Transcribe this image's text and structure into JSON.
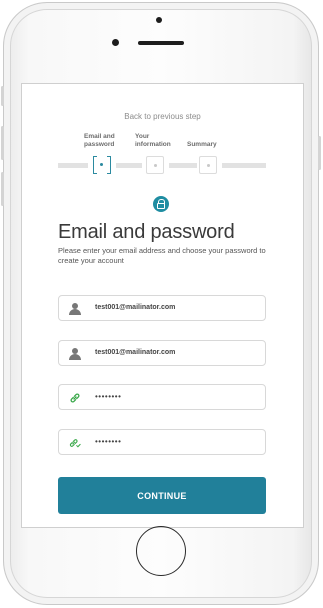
{
  "nav": {
    "back_label": "Back to previous step"
  },
  "steps": [
    {
      "label": "Email and\npassword",
      "state": "active"
    },
    {
      "label": "Your\ninformation",
      "state": "pending"
    },
    {
      "label": "Summary",
      "state": "pending"
    }
  ],
  "form": {
    "icon": "lock-icon",
    "title": "Email and password",
    "subtitle": "Please enter your email address and choose your password to create your account",
    "email_value": "test001@mailinator.com",
    "email_confirm_value": "test001@mailinator.com",
    "password_value": "••••••••",
    "password_confirm_value": "••••••••",
    "continue_label": "CONTINUE"
  },
  "colors": {
    "accent": "#21809a",
    "icon_green": "#3aa84a"
  }
}
